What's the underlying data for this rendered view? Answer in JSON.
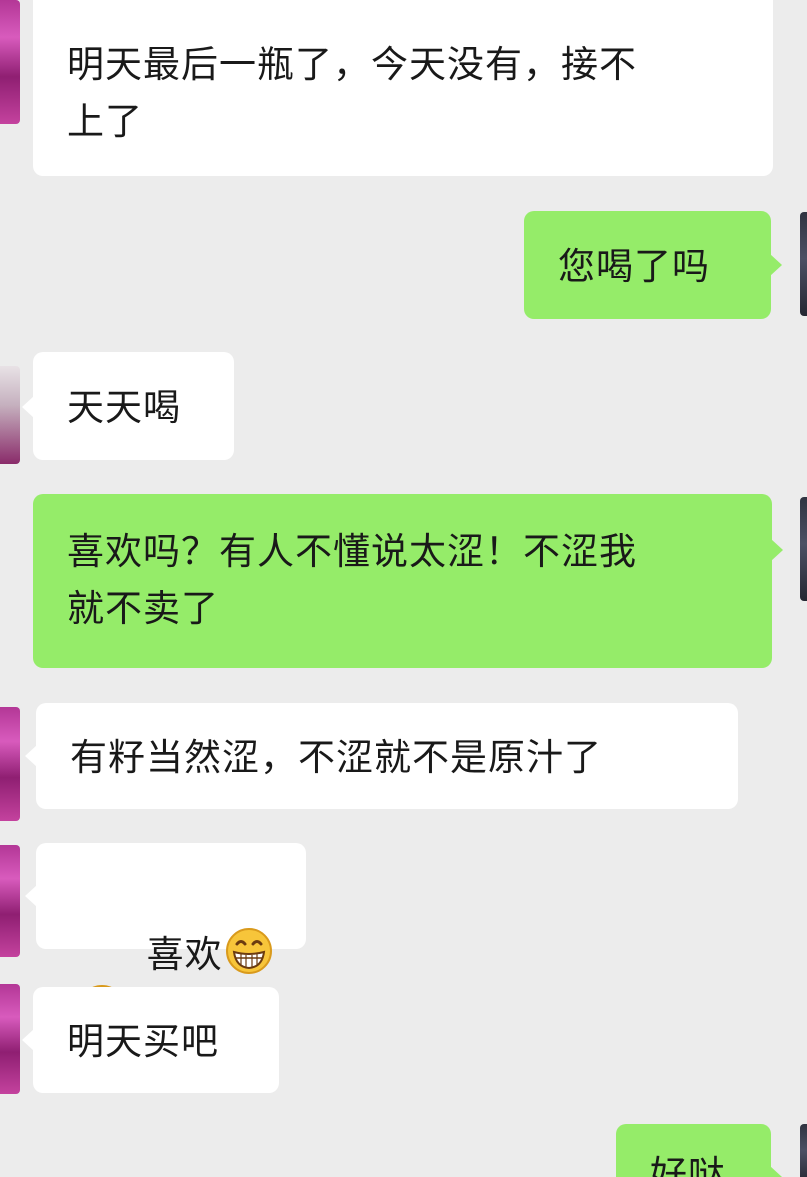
{
  "chat": {
    "messages": [
      {
        "side": "in",
        "text": "明天最后一瓶了，今天没有，接不\n上了"
      },
      {
        "side": "out",
        "text": "您喝了吗"
      },
      {
        "side": "in",
        "text": "天天喝"
      },
      {
        "side": "out",
        "text": "喜欢吗？有人不懂说太涩！不涩我\n就不卖了"
      },
      {
        "side": "in",
        "text": "有籽当然涩，不涩就不是原汁了"
      },
      {
        "side": "in",
        "text": "喜欢",
        "emoji": [
          "grin-icon",
          "grin-icon"
        ]
      },
      {
        "side": "in",
        "text": "明天买吧"
      },
      {
        "side": "out",
        "text": "好哒"
      }
    ]
  },
  "colors": {
    "background": "#ececec",
    "incoming_bubble": "#ffffff",
    "outgoing_bubble": "#95ec69",
    "text": "#191919"
  }
}
